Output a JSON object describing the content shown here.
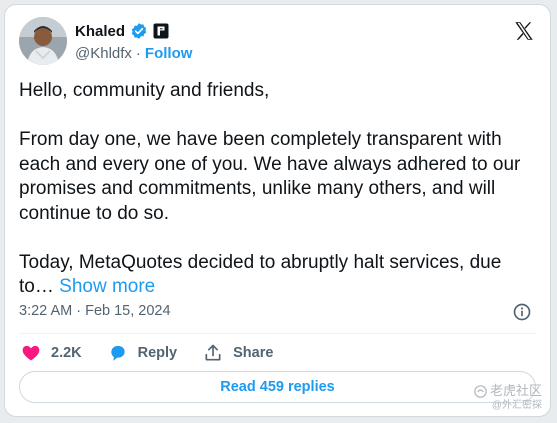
{
  "author": {
    "name": "Khaled",
    "handle": "@Khldfx",
    "separator": "·",
    "follow_label": "Follow"
  },
  "tweet": {
    "paragraphs": [
      "Hello, community and friends,",
      "From day one, we have been completely transparent with each and every one of you. We have always adhered to our promises and commitments, unlike many others, and will continue to do so.",
      "Today, MetaQuotes decided to abruptly halt services, due to…"
    ],
    "show_more_label": "Show more",
    "timestamp": "3:22 AM · Feb 15, 2024"
  },
  "actions": {
    "likes": "2.2K",
    "reply_label": "Reply",
    "share_label": "Share"
  },
  "read_replies_label": "Read 459 replies",
  "watermark": {
    "title": "老虎社区",
    "subtitle": "@外汇密探"
  },
  "colors": {
    "accent": "#1d9bf0",
    "like": "#f91880",
    "muted": "#536471"
  }
}
